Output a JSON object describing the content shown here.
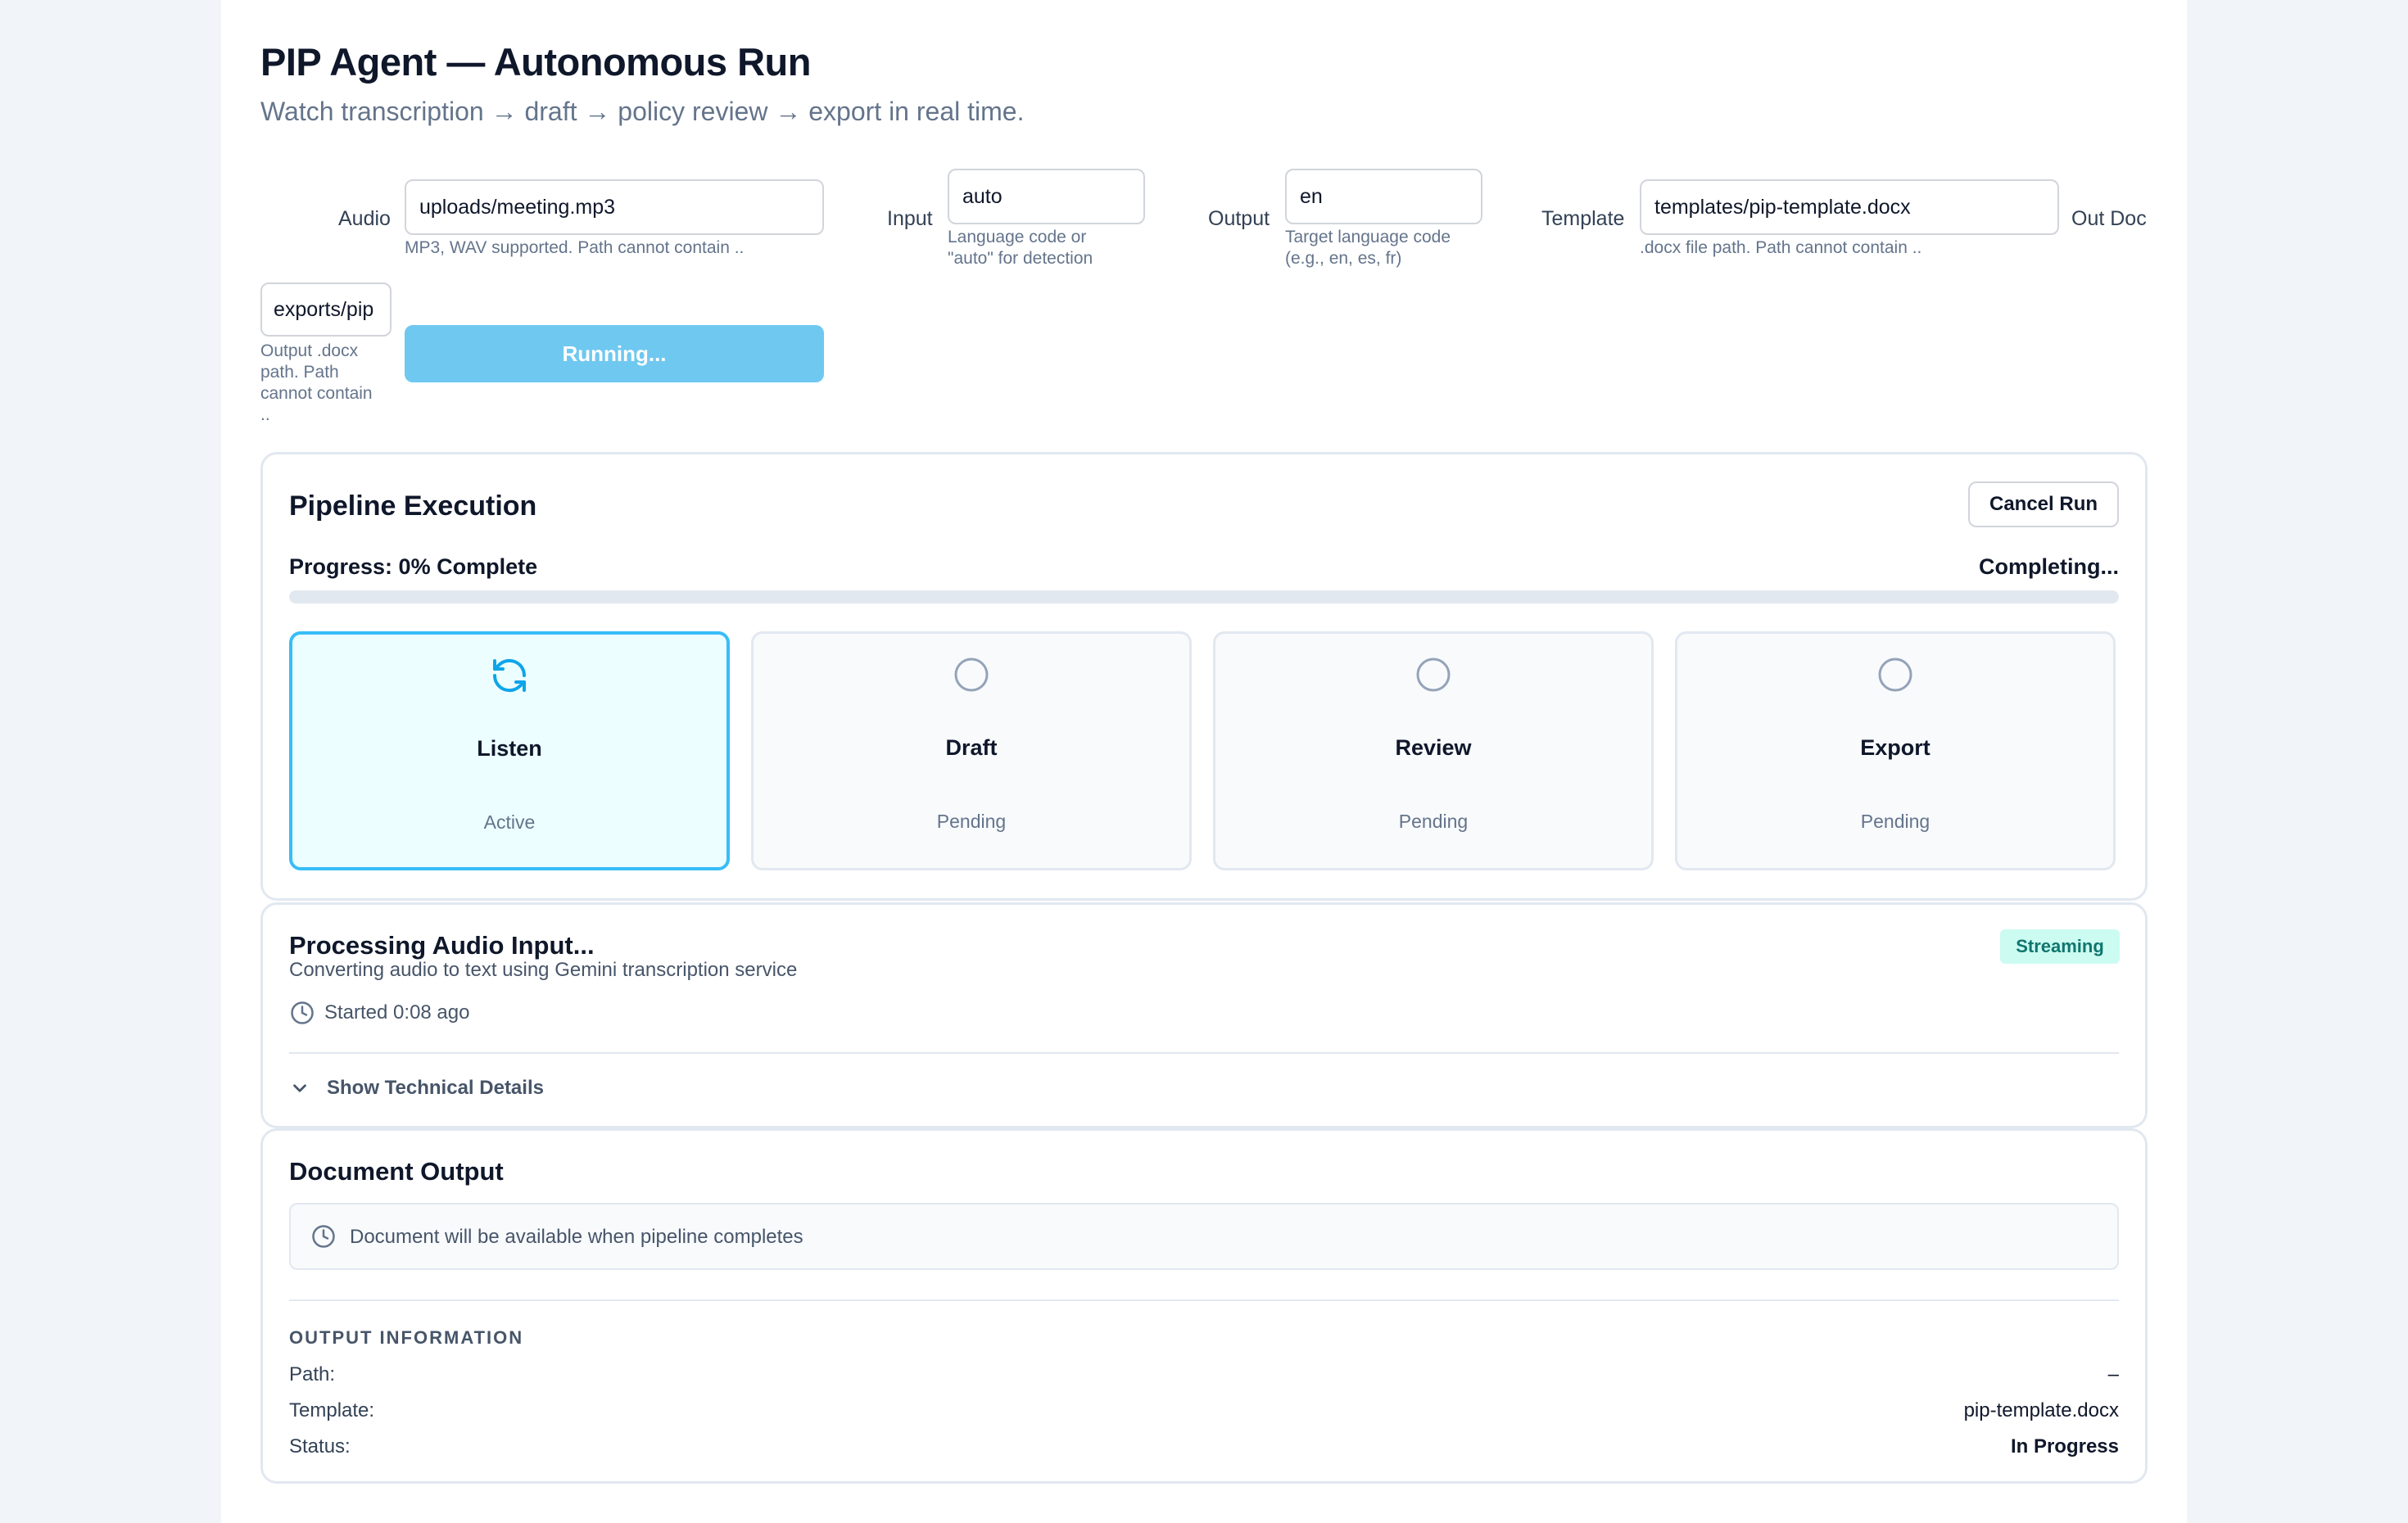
{
  "header": {
    "title": "PIP Agent — Autonomous Run",
    "subtitle": "Watch transcription → draft → policy review → export in real time."
  },
  "form": {
    "audio": {
      "label": "Audio",
      "value": "uploads/meeting.mp3",
      "help": "MP3, WAV supported. Path cannot contain .."
    },
    "input_lang": {
      "label": "Input",
      "value": "auto",
      "help_line1": "Language code or",
      "help_line2": "\"auto\" for detection"
    },
    "output_lang": {
      "label": "Output",
      "value": "en",
      "help_line1": "Target language code",
      "help_line2": "(e.g., en, es, fr)"
    },
    "template": {
      "label": "Template",
      "value": "templates/pip-template.docx",
      "help": ".docx file path. Path cannot contain .."
    },
    "out_doc": {
      "label": "Out Doc",
      "value": "exports/pip",
      "help_line1": "Output .docx",
      "help_line2": "path. Path",
      "help_line3": "cannot contain",
      "help_line4": ".."
    },
    "run_button": "Running..."
  },
  "pipeline": {
    "title": "Pipeline Execution",
    "cancel_label": "Cancel Run",
    "progress_label": "Progress: 0% Complete",
    "progress_status": "Completing...",
    "progress_value": 0,
    "accent_color": "#0ea5e9",
    "steps": [
      {
        "name": "Listen",
        "status": "Active",
        "icon": "refresh-icon"
      },
      {
        "name": "Draft",
        "status": "Pending",
        "icon": "circle-icon"
      },
      {
        "name": "Review",
        "status": "Pending",
        "icon": "circle-icon"
      },
      {
        "name": "Export",
        "status": "Pending",
        "icon": "circle-icon"
      }
    ]
  },
  "processing": {
    "title": "Processing Audio Input...",
    "description": "Converting audio to text using Gemini transcription service",
    "badge": "Streaming",
    "started": "Started 0:08 ago",
    "details_toggle": "Show Technical Details"
  },
  "document": {
    "title": "Document Output",
    "notice": "Document will be available when pipeline completes",
    "info_heading": "OUTPUT INFORMATION",
    "path_label": "Path:",
    "path_value": "–",
    "template_label": "Template:",
    "template_value": "pip-template.docx",
    "status_label": "Status:",
    "status_value": "In Progress"
  }
}
